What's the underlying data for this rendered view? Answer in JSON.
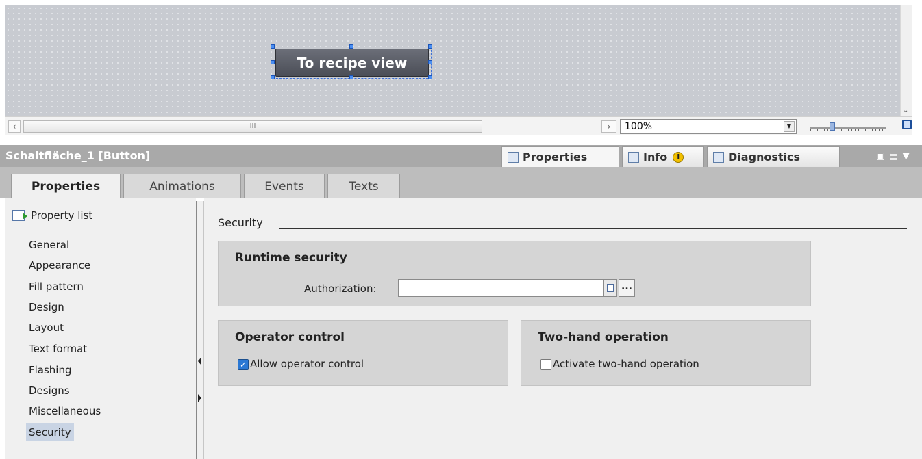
{
  "canvas": {
    "button_text": "To recipe view"
  },
  "canvas_bar": {
    "zoom_value": "100%",
    "scroll_left_icon": "arrow-left-icon",
    "scroll_right_icon": "arrow-right-icon",
    "thumb_grip": "III"
  },
  "inspector": {
    "title": "Schaltfläche_1 [Button]",
    "right_tabs": [
      {
        "label": "Properties",
        "icon": "properties-icon"
      },
      {
        "label": "Info",
        "icon": "info-icon"
      },
      {
        "label": "Diagnostics",
        "icon": "diagnostics-icon"
      }
    ],
    "info_badge": "i"
  },
  "subtabs": [
    "Properties",
    "Animations",
    "Events",
    "Texts"
  ],
  "nav": {
    "property_list": "Property list",
    "items": [
      "General",
      "Appearance",
      "Fill pattern",
      "Design",
      "Layout",
      "Text format",
      "Flashing",
      "Designs",
      "Miscellaneous",
      "Security"
    ],
    "active": "Security"
  },
  "security": {
    "section_title": "Security",
    "runtime": {
      "title": "Runtime security",
      "auth_label": "Authorization:",
      "auth_value": "",
      "more_label": "..."
    },
    "operator": {
      "title": "Operator control",
      "checkbox_label": "Allow operator control",
      "checked": true
    },
    "twohand": {
      "title": "Two-hand operation",
      "checkbox_label": "Activate two-hand operation",
      "checked": false
    }
  }
}
